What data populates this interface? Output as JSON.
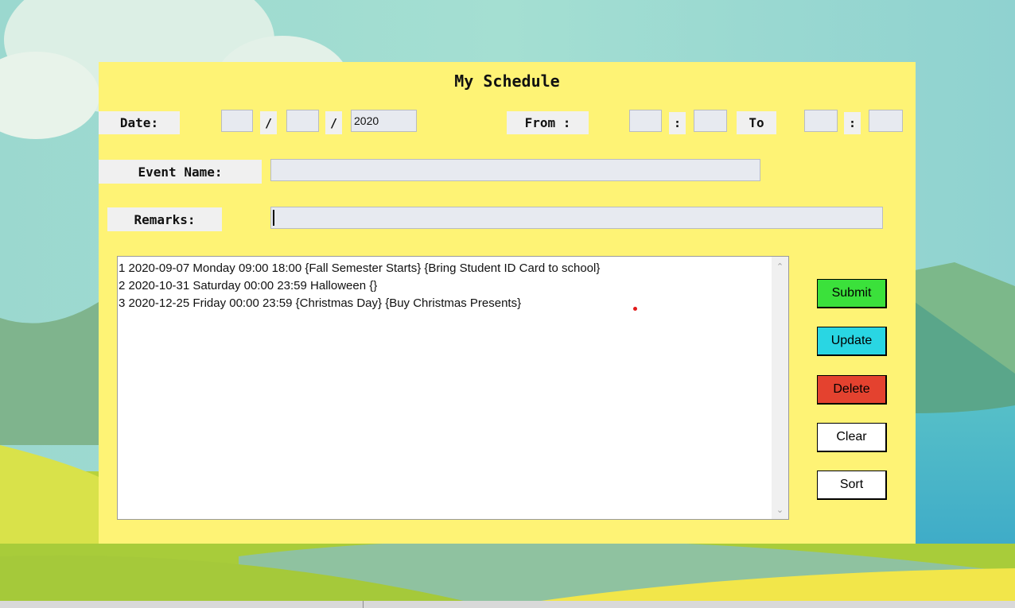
{
  "app": {
    "title": "My Schedule"
  },
  "labels": {
    "date": "Date:",
    "date_sep": "/",
    "from": "From :",
    "time_sep": ":",
    "to": "To",
    "event_name": "Event Name:",
    "remarks": "Remarks:"
  },
  "fields": {
    "day": "",
    "month": "",
    "year": "2020",
    "from_hour": "",
    "from_minute": "",
    "to_hour": "",
    "to_minute": "",
    "event_name": "",
    "remarks": ""
  },
  "schedule_list": [
    "1 2020-09-07 Monday 09:00 18:00 {Fall Semester Starts} {Bring Student ID Card to school}",
    "2 2020-10-31 Saturday 00:00 23:59 Halloween {}",
    "3 2020-12-25 Friday 00:00 23:59 {Christmas Day} {Buy Christmas Presents}"
  ],
  "buttons": [
    {
      "name": "submit-button",
      "label": "Submit",
      "color": "#3be13b"
    },
    {
      "name": "update-button",
      "label": "Update",
      "color": "#29d6e3"
    },
    {
      "name": "delete-button",
      "label": "Delete",
      "color": "#e4422f"
    },
    {
      "name": "clear-button",
      "label": "Clear",
      "color": "#ffffff"
    },
    {
      "name": "sort-button",
      "label": "Sort",
      "color": "#ffffff"
    }
  ],
  "icons": {
    "scroll_up": "chevron-up-icon",
    "scroll_down": "chevron-down-icon"
  },
  "colors": {
    "panel": "#fef375",
    "label_bg": "#f0f0f0",
    "field_bg": "#e7eaf0"
  }
}
